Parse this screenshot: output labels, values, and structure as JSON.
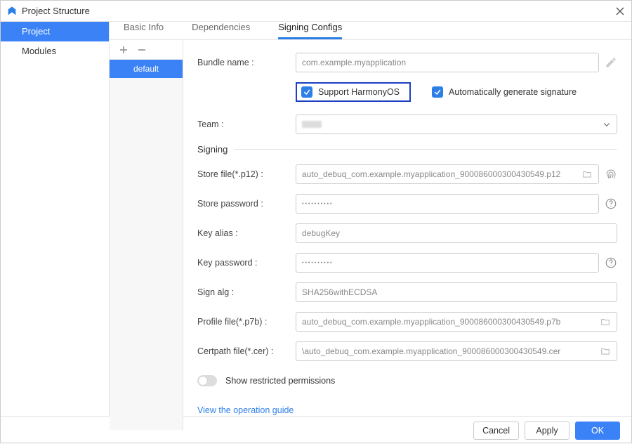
{
  "window": {
    "title": "Project Structure"
  },
  "sidebar": {
    "items": [
      {
        "label": "Project",
        "selected": true
      },
      {
        "label": "Modules",
        "selected": false
      }
    ]
  },
  "tabs": [
    {
      "label": "Basic Info"
    },
    {
      "label": "Dependencies"
    },
    {
      "label": "Signing Configs",
      "active": true
    }
  ],
  "config_list": {
    "items": [
      {
        "label": "default"
      }
    ]
  },
  "form": {
    "bundle_name": {
      "label": "Bundle name :",
      "value": "com.example.myapplication"
    },
    "support_harmony": {
      "label": "Support HarmonyOS",
      "checked": true
    },
    "auto_sign": {
      "label": "Automatically generate signature",
      "checked": true
    },
    "team": {
      "label": "Team :",
      "value": ""
    },
    "signing_header": "Signing",
    "store_file": {
      "label": "Store file(*.p12) :",
      "value": "auto_debuq_com.example.myapplication_900086000300430549.p12"
    },
    "store_password": {
      "label": "Store password :",
      "value": "••••••••••"
    },
    "key_alias": {
      "label": "Key alias :",
      "value": "debugKey"
    },
    "key_password": {
      "label": "Key password :",
      "value": "••••••••••"
    },
    "sign_alg": {
      "label": "Sign alg :",
      "value": "SHA256withECDSA"
    },
    "profile_file": {
      "label": "Profile file(*.p7b) :",
      "value": "auto_debuq_com.example.myapplication_900086000300430549.p7b"
    },
    "certpath_file": {
      "label": "Certpath file(*.cer) :",
      "value": "\\auto_debuq_com.example.myapplication_900086000300430549.cer"
    },
    "restricted_toggle": {
      "label": "Show restricted permissions",
      "checked": false
    },
    "guide_link": "View the operation guide"
  },
  "footer": {
    "cancel": "Cancel",
    "apply": "Apply",
    "ok": "OK"
  }
}
